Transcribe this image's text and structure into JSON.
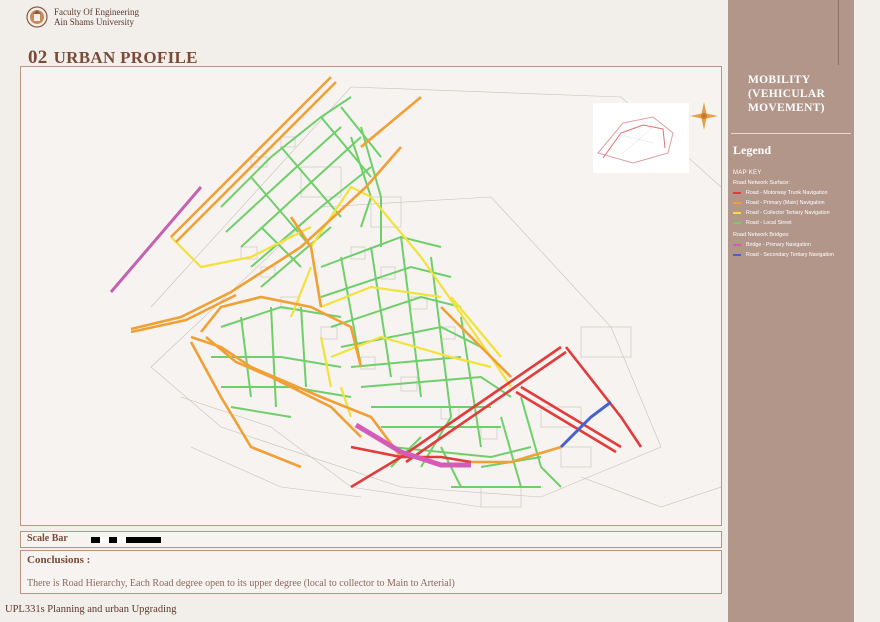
{
  "header": {
    "line1": "Faculty Of Engineering",
    "line2": "Ain Shams University"
  },
  "page_title": {
    "number": "02",
    "text": "URBAN PROFILE"
  },
  "sidebar": {
    "title": "MOBILITY (VEHICULAR MOVEMENT)",
    "legend_title": "Legend",
    "map_key": "MAP KEY",
    "group1": "Road Network Surface:",
    "items1": [
      {
        "label": "Road - Motorway Trunk Navigation",
        "color": "#e23b3b"
      },
      {
        "label": "Road - Primary (Main) Navigation",
        "color": "#f0a035"
      },
      {
        "label": "Road - Collector Tertiary Navigation",
        "color": "#f2e23a"
      },
      {
        "label": "Road - Local Street",
        "color": "#6fcf6a"
      }
    ],
    "group2": "Road Network Bridges:",
    "items2": [
      {
        "label": "Bridge - Primary Navigation",
        "color": "#d45cb8"
      },
      {
        "label": "Road - Secondary Tertiary Navigation",
        "color": "#4a5fd0"
      }
    ]
  },
  "scale": {
    "label": "Scale Bar"
  },
  "conclusions": {
    "title": "Conclusions :",
    "text": "There is Road Hierarchy, Each Road degree open to its upper degree (local to collector to Main to Arterial)"
  },
  "footer": {
    "course": "UPL331s Planning and urban Upgrading"
  }
}
